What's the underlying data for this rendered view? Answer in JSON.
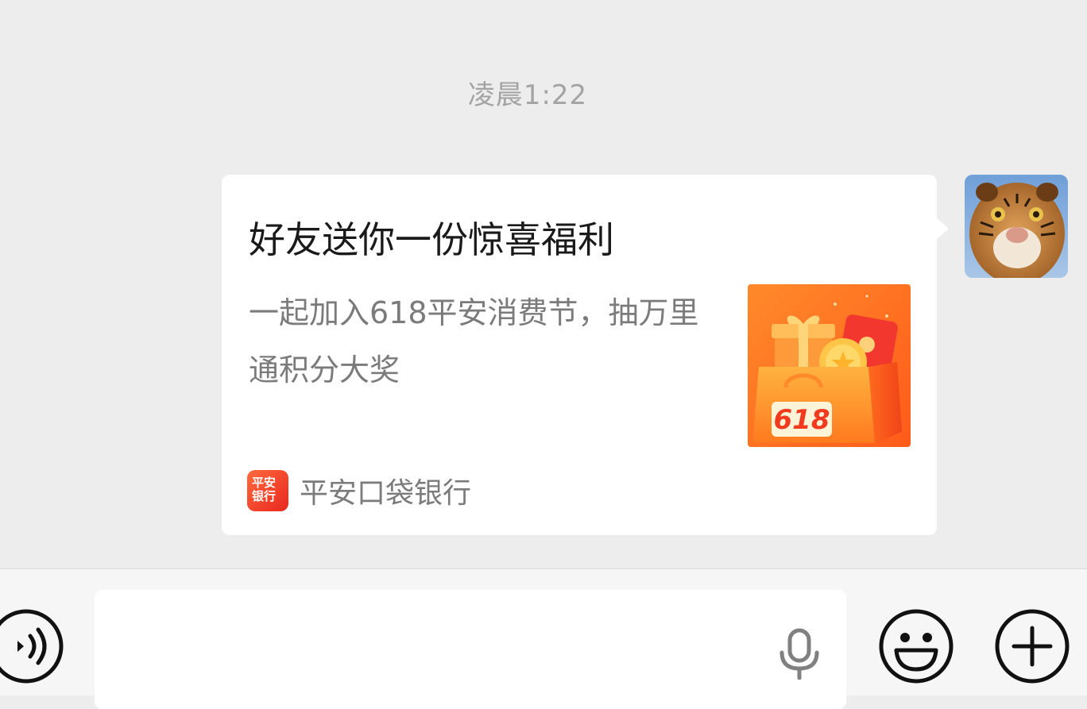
{
  "chat": {
    "timestamp": "凌晨1:22"
  },
  "card": {
    "title": "好友送你一份惊喜福利",
    "description": "一起加入618平安消费节，抽万里通积分大奖",
    "thumbnail_text": "618",
    "source_name": "平安口袋银行",
    "source_logo_text": [
      "平安",
      "银行"
    ]
  },
  "input_bar": {
    "text_value": "",
    "placeholder": ""
  },
  "icons": {
    "voice": "voice-icon",
    "mic": "microphone-icon",
    "emoji": "emoji-icon",
    "plus": "plus-icon"
  },
  "colors": {
    "chat_background": "#ededed",
    "bubble": "#ffffff",
    "input_bar": "#f6f6f6",
    "accent_orange": "#ff6a1f"
  }
}
